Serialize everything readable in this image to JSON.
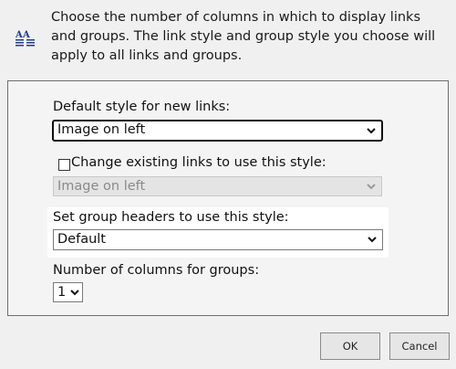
{
  "intro_text": "Choose the number of columns in which to display links and groups. The link style and group style you choose will apply to all links and groups.",
  "icons": {
    "header": "text-columns-icon",
    "dropdown": "chevron-down-icon"
  },
  "fields": {
    "default_style_label": "Default style for new links:",
    "default_style_value": "Image on left",
    "change_existing_label": "Change existing links to use this style:",
    "change_existing_checked": false,
    "change_existing_value": "Image on left",
    "group_headers_label": "Set group headers to use this style:",
    "group_headers_value": "Default",
    "columns_label": "Number of columns for groups:",
    "columns_value": "1"
  },
  "buttons": {
    "ok": "OK",
    "cancel": "Cancel"
  },
  "colors": {
    "background": "#f0f0f0",
    "highlight": "#ffffff",
    "icon_blue": "#1e3c8c"
  }
}
